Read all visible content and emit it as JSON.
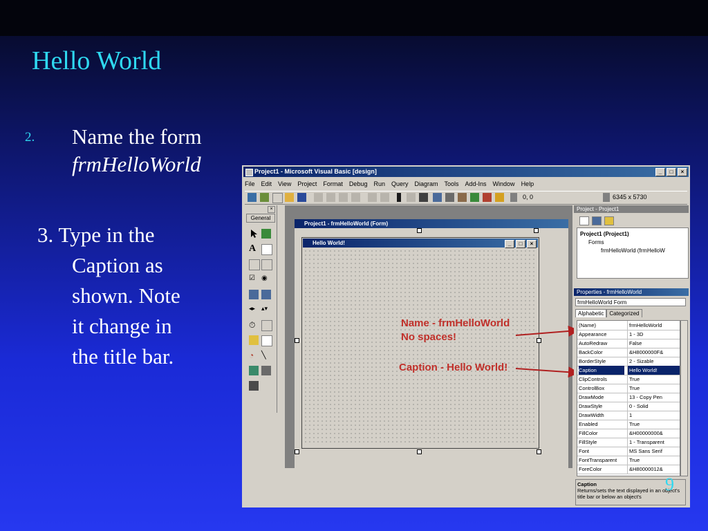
{
  "slide": {
    "title": "Hello World",
    "step2_number": "2.",
    "step2_text": "Name the form",
    "step2_italic": "frmHelloWorld",
    "step3_lines": [
      "3.  Type in the",
      "Caption as",
      "shown.  Note",
      "it change in",
      "the title bar."
    ],
    "page_number": "9"
  },
  "ide": {
    "title": "Project1 - Microsoft Visual Basic [design]",
    "window_buttons": [
      "_",
      "□",
      "×"
    ],
    "menu": [
      "File",
      "Edit",
      "View",
      "Project",
      "Format",
      "Debug",
      "Run",
      "Query",
      "Diagram",
      "Tools",
      "Add-Ins",
      "Window",
      "Help"
    ],
    "toolbar": {
      "position": "0, 0",
      "size": "6345 x 5730"
    },
    "toolbox": {
      "tab": "General"
    },
    "project_window_title": "Project1 - frmHelloWorld (Form)",
    "form_title": "Hello World!",
    "annotations": {
      "name_line1": "Name - frmHelloWorld",
      "name_line2": "No spaces!",
      "caption": "Caption - Hello World!"
    },
    "project_explorer": {
      "title": "Project - Project1",
      "tree": [
        "Project1 (Project1)",
        "Forms",
        "frmHelloWorld (frmHelloW"
      ]
    },
    "properties": {
      "title": "Properties - frmHelloWorld",
      "object": "frmHelloWorld  Form",
      "tabs": [
        "Alphabetic",
        "Categorized"
      ],
      "rows": [
        {
          "name": "(Name)",
          "value": "frmHelloWorld"
        },
        {
          "name": "Appearance",
          "value": "1 - 3D"
        },
        {
          "name": "AutoRedraw",
          "value": "False"
        },
        {
          "name": "BackColor",
          "value": "&H8000000F&"
        },
        {
          "name": "BorderStyle",
          "value": "2 - Sizable"
        },
        {
          "name": "Caption",
          "value": "Hello World!"
        },
        {
          "name": "ClipControls",
          "value": "True"
        },
        {
          "name": "ControlBox",
          "value": "True"
        },
        {
          "name": "DrawMode",
          "value": "13 - Copy Pen"
        },
        {
          "name": "DrawStyle",
          "value": "0 - Solid"
        },
        {
          "name": "DrawWidth",
          "value": "1"
        },
        {
          "name": "Enabled",
          "value": "True"
        },
        {
          "name": "FillColor",
          "value": "&H00000000&"
        },
        {
          "name": "FillStyle",
          "value": "1 - Transparent"
        },
        {
          "name": "Font",
          "value": "MS Sans Serif"
        },
        {
          "name": "FontTransparent",
          "value": "True"
        },
        {
          "name": "ForeColor",
          "value": "&H80000012&"
        }
      ],
      "selected_row": "Caption",
      "description_title": "Caption",
      "description_text": "Returns/sets the text displayed in an object's title bar or below an object's"
    },
    "colors": {
      "titlebar": "#0a246a",
      "annotation": "#c0302a",
      "arrow": "#b02020"
    }
  }
}
